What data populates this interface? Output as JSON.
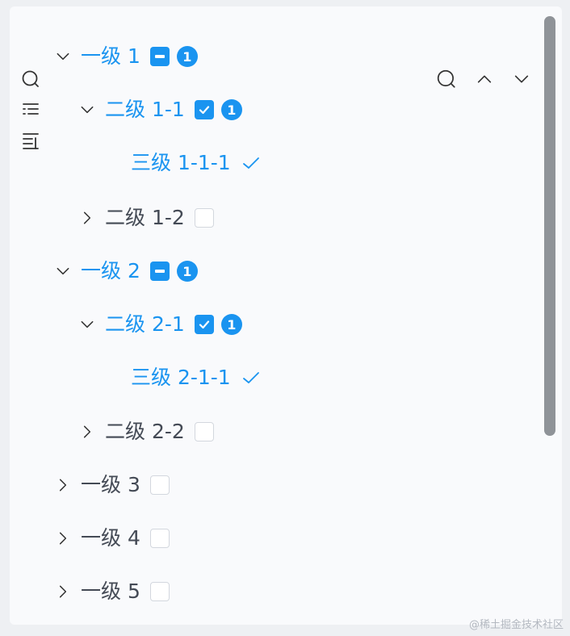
{
  "colors": {
    "accent": "#1a94f0",
    "text": "#444a55",
    "muted": "#d3d7de"
  },
  "toolbar": {
    "side_icons": [
      "search-icon",
      "list-icon",
      "align-icon"
    ],
    "top_icons": [
      "search-icon",
      "chevron-up-icon",
      "chevron-down-icon"
    ]
  },
  "tree": [
    {
      "label": "一级 1",
      "state": "indeterminate",
      "badge": "1",
      "expanded": true,
      "active": true
    },
    {
      "label": "二级 1-1",
      "state": "checked",
      "badge": "1",
      "expanded": true,
      "active": true
    },
    {
      "label": "三级 1-1-1",
      "selected": true,
      "active": true
    },
    {
      "label": "二级 1-2",
      "state": "unchecked",
      "expanded": false
    },
    {
      "label": "一级 2",
      "state": "indeterminate",
      "badge": "1",
      "expanded": true,
      "active": true
    },
    {
      "label": "二级 2-1",
      "state": "checked",
      "badge": "1",
      "expanded": true,
      "active": true
    },
    {
      "label": "三级 2-1-1",
      "selected": true,
      "active": true
    },
    {
      "label": "二级 2-2",
      "state": "unchecked",
      "expanded": false
    },
    {
      "label": "一级 3",
      "state": "unchecked",
      "expanded": false
    },
    {
      "label": "一级 4",
      "state": "unchecked",
      "expanded": false
    },
    {
      "label": "一级 5",
      "state": "unchecked",
      "expanded": false
    }
  ],
  "watermark": "@稀土掘金技术社区"
}
